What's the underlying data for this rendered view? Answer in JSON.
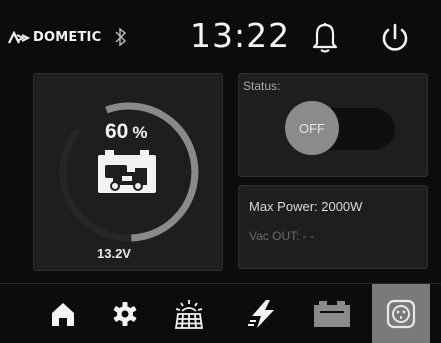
{
  "header": {
    "brand": "DOMETIC",
    "time": "13:22",
    "icons": [
      "dometic-logo",
      "bluetooth-icon",
      "bell-icon",
      "power-icon"
    ]
  },
  "battery": {
    "soc_value": "60",
    "soc_unit": "%",
    "soc_fraction": 0.6,
    "voltage": "13.2V",
    "icon": "battery-charging-icon"
  },
  "status": {
    "label": "Status:",
    "toggle_text": "OFF",
    "state": "off"
  },
  "power": {
    "max_power": "Max Power: 2000W",
    "vac_out": "Vac OUT:  - -"
  },
  "nav": {
    "items": [
      "home",
      "settings",
      "solar",
      "charging",
      "battery",
      "outlet"
    ],
    "active": "outlet"
  },
  "colors": {
    "background": "#0c0c0c",
    "panel": "#1e1e1e",
    "ring": "#8a8a8a",
    "active_nav": "#7a7a7a"
  }
}
